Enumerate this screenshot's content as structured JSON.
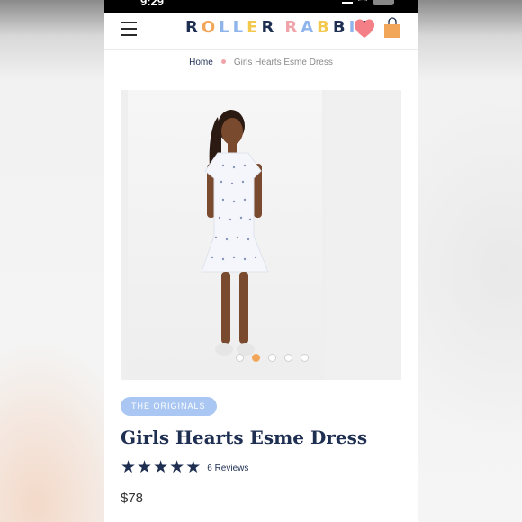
{
  "status_bar": {
    "time": "9:29"
  },
  "header": {
    "logo_text": "ROLLER RABBIT",
    "logo_colors": [
      "#1e2f52",
      "#f2a65a",
      "#8fb4ec",
      "#8fb4ec",
      "#f2c94c",
      "#1e2f52",
      "#f0a3a8",
      "#8fb4ec",
      "#f2c94c",
      "#1e2f52",
      "#8fb4ec",
      "#1e2f52",
      "#f2c94c"
    ],
    "heart_color": "#f47f86",
    "bag_color": "#f2a65a"
  },
  "breadcrumb": {
    "home": "Home",
    "current": "Girls Hearts Esme Dress"
  },
  "gallery": {
    "slide_count": 5,
    "active_slide": 1
  },
  "product": {
    "collection_badge": "THE ORIGINALS",
    "title": "Girls Hearts Esme Dress",
    "rating_stars": 5,
    "reviews": "6 Reviews",
    "price": "$78"
  },
  "colors": {
    "navy": "#1e2f52",
    "badge_blue": "#a9c7f2",
    "accent_orange": "#f2a65a",
    "pink": "#f0a3a8"
  }
}
